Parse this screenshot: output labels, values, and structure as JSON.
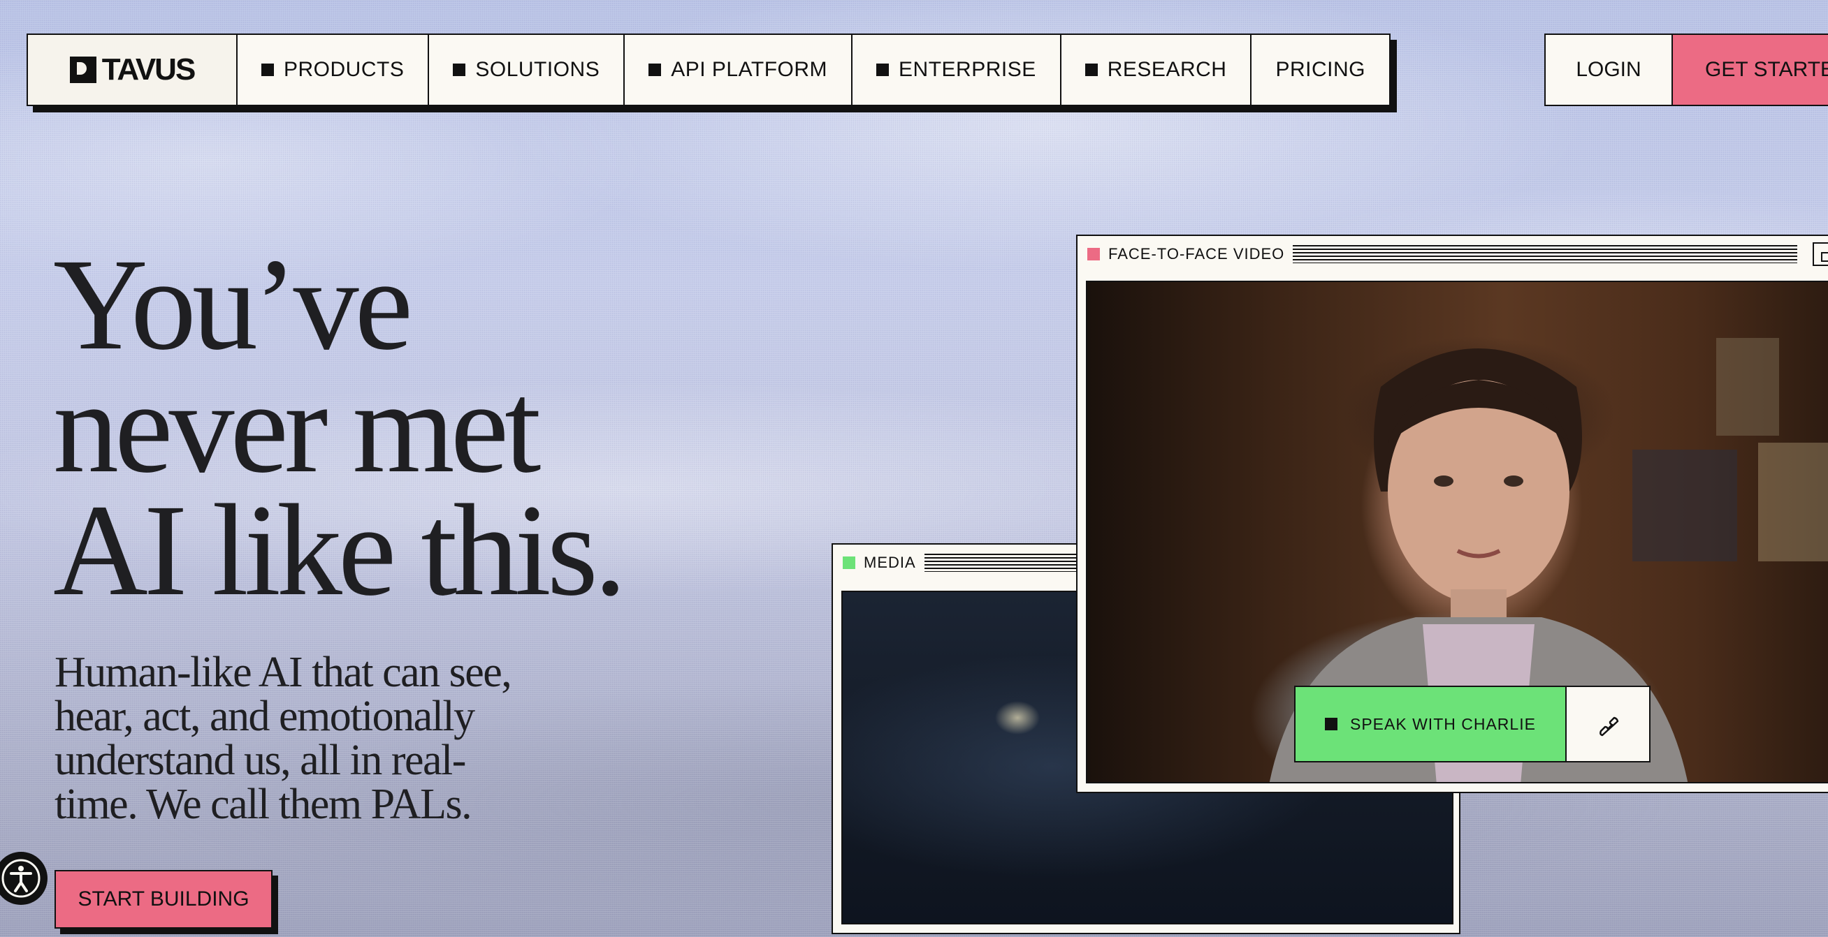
{
  "brand": {
    "name": "TAVUS"
  },
  "nav": {
    "items": [
      {
        "label": "PRODUCTS",
        "icon": "square-bullet-icon"
      },
      {
        "label": "SOLUTIONS",
        "icon": "square-bullet-icon"
      },
      {
        "label": "API PLATFORM",
        "icon": "square-bullet-icon"
      },
      {
        "label": "ENTERPRISE",
        "icon": "square-bullet-icon"
      },
      {
        "label": "RESEARCH",
        "icon": "square-bullet-icon"
      },
      {
        "label": "PRICING"
      }
    ],
    "login": "LOGIN",
    "get_started": "GET STARTED"
  },
  "hero": {
    "title_line1": "You’ve",
    "title_line2": "never met",
    "title_line3": "AI like this.",
    "subtitle": "Human-like AI that can see, hear, act, and emotionally understand us, all in real-time. We call them PALs.",
    "cta": "START BUILDING"
  },
  "windows": {
    "face": {
      "title": "FACE-TO-FACE VIDEO",
      "dot_color": "#ec6b84"
    },
    "media": {
      "title": "MEDIA",
      "dot_color": "#6ce278"
    }
  },
  "call": {
    "speak_label": "SPEAK WITH CHARLIE"
  },
  "colors": {
    "accent_pink": "#ec6b84",
    "accent_green": "#6ce278",
    "ink": "#111111",
    "paper": "#fbf9f3"
  }
}
